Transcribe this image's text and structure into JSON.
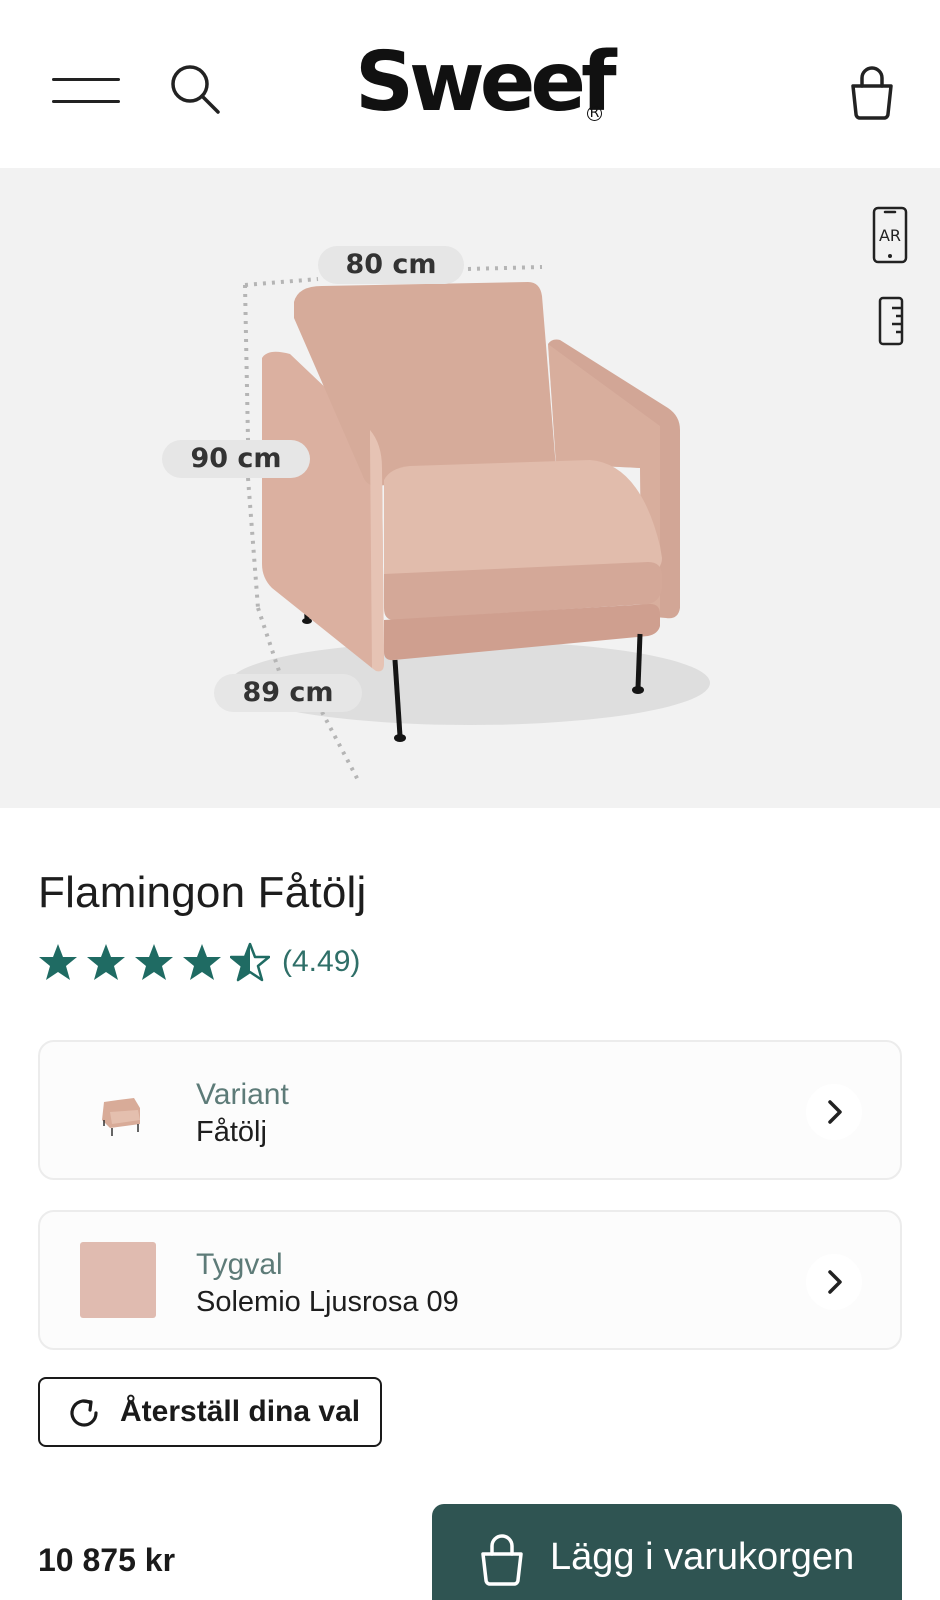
{
  "header": {
    "logo_text": "Sweef",
    "logo_mark": "R",
    "icons": [
      "menu-icon",
      "search-icon",
      "shopping-bag-icon"
    ]
  },
  "gallery": {
    "dimensions": {
      "width": "80 cm",
      "height": "90 cm",
      "depth": "89 cm"
    },
    "ar_label": "AR",
    "icons": [
      "ar-phone-icon",
      "ruler-icon"
    ]
  },
  "product": {
    "title": "Flamingon Fåtölj",
    "rating": {
      "value": 4.49,
      "display": "(4.49)",
      "max": 5
    }
  },
  "options": {
    "variant": {
      "label": "Variant",
      "value": "Fåtölj"
    },
    "fabric": {
      "label": "Tygval",
      "value": "Solemio Ljusrosa 09"
    }
  },
  "actions": {
    "reset_label": "Återställ dina val",
    "add_to_cart_label": "Lägg i varukorgen"
  },
  "price": "10 875 kr",
  "colors": {
    "accent": "#2f5452",
    "rating_teal": "#1f6b63",
    "fabric": "#e0bbb0",
    "gallery_bg": "#f2f2f2"
  }
}
